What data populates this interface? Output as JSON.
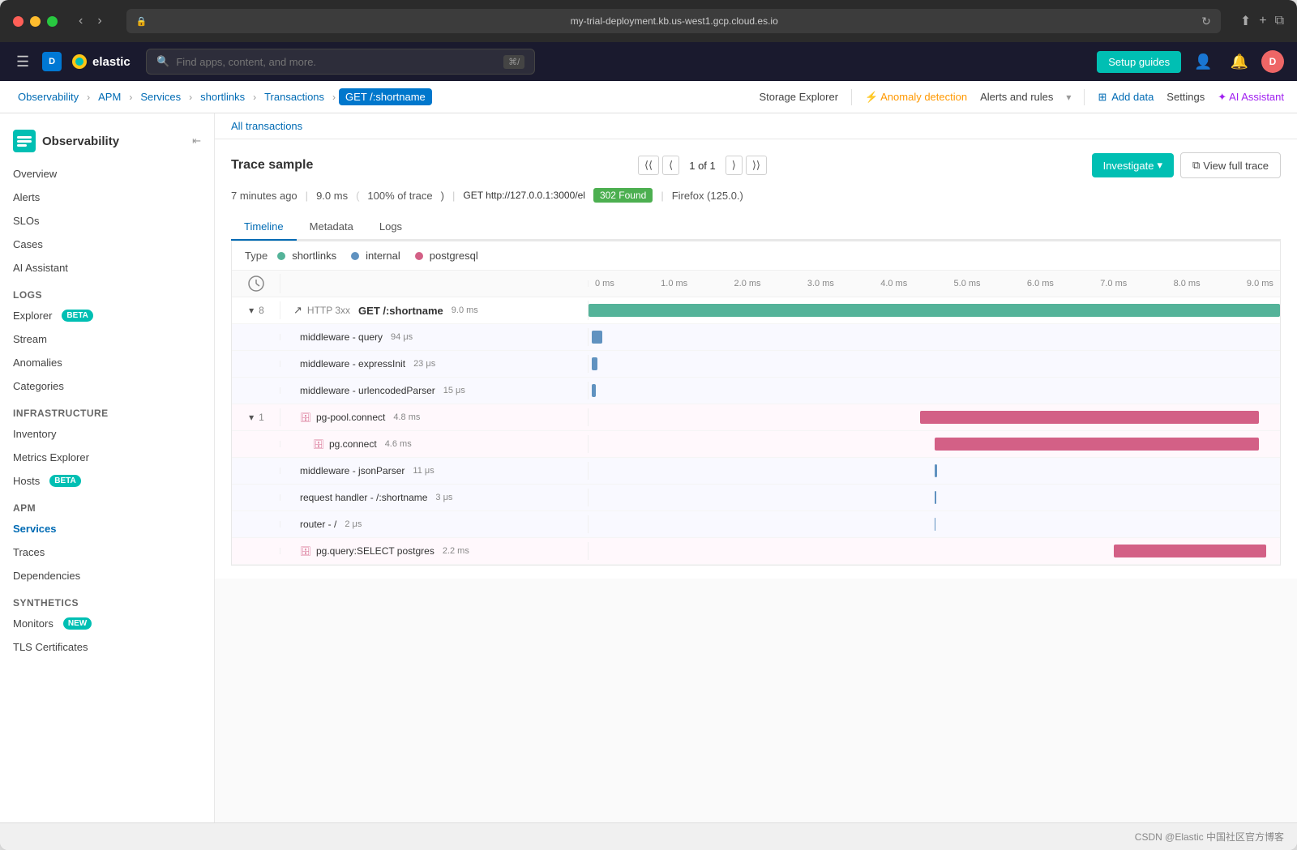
{
  "window": {
    "url": "my-trial-deployment.kb.us-west1.gcp.cloud.es.io"
  },
  "topnav": {
    "search_placeholder": "Find apps, content, and more.",
    "search_kbd": "⌘/",
    "setup_guides": "Setup guides",
    "app_initial": "D"
  },
  "breadcrumbs": [
    {
      "label": "Observability",
      "active": false
    },
    {
      "label": "APM",
      "active": false
    },
    {
      "label": "Services",
      "active": false
    },
    {
      "label": "shortlinks",
      "active": false
    },
    {
      "label": "Transactions",
      "active": false
    },
    {
      "label": "GET /:shortname",
      "active": true
    }
  ],
  "topbar_links": [
    {
      "label": "Storage Explorer",
      "type": "plain"
    },
    {
      "label": "Anomaly detection",
      "type": "anomaly"
    },
    {
      "label": "Alerts and rules",
      "type": "plain"
    },
    {
      "label": "Add data",
      "type": "add"
    },
    {
      "label": "Settings",
      "type": "plain"
    },
    {
      "label": "AI Assistant",
      "type": "ai"
    }
  ],
  "sidebar": {
    "title": "Observability",
    "items_top": [
      {
        "label": "Overview",
        "active": false
      },
      {
        "label": "Alerts",
        "active": false
      },
      {
        "label": "SLOs",
        "active": false
      },
      {
        "label": "Cases",
        "active": false
      },
      {
        "label": "AI Assistant",
        "active": false
      }
    ],
    "sections": [
      {
        "label": "Logs",
        "items": [
          {
            "label": "Explorer",
            "badge": "BETA",
            "active": false
          },
          {
            "label": "Stream",
            "active": false
          },
          {
            "label": "Anomalies",
            "active": false
          },
          {
            "label": "Categories",
            "active": false
          }
        ]
      },
      {
        "label": "Infrastructure",
        "items": [
          {
            "label": "Inventory",
            "active": false
          },
          {
            "label": "Metrics Explorer",
            "active": false
          },
          {
            "label": "Hosts",
            "badge": "BETA",
            "active": false
          }
        ]
      },
      {
        "label": "APM",
        "items": [
          {
            "label": "Services",
            "active": true
          },
          {
            "label": "Traces",
            "active": false
          },
          {
            "label": "Dependencies",
            "active": false
          }
        ]
      },
      {
        "label": "Synthetics",
        "items": [
          {
            "label": "Monitors",
            "badge": "NEW",
            "active": false
          },
          {
            "label": "TLS Certificates",
            "active": false
          }
        ]
      }
    ]
  },
  "transactions_notice": {
    "text": "All transactions"
  },
  "trace_sample": {
    "title": "Trace sample",
    "page_current": "1",
    "page_total": "1",
    "investigate_label": "Investigate",
    "view_full_trace": "View full trace",
    "time_ago": "7 minutes ago",
    "duration": "9.0 ms",
    "duration_pct": "100% of trace",
    "url": "GET http://127.0.0.1:3000/el",
    "status": "302 Found",
    "browser": "Firefox (125.0.)"
  },
  "tabs": [
    {
      "label": "Timeline",
      "active": true
    },
    {
      "label": "Metadata",
      "active": false
    },
    {
      "label": "Logs",
      "active": false
    }
  ],
  "timeline": {
    "type_label": "Type",
    "types": [
      {
        "label": "shortlinks",
        "color": "#54b399"
      },
      {
        "label": "internal",
        "color": "#6092c0"
      },
      {
        "label": "postgresql",
        "color": "#d36086"
      }
    ],
    "time_axis": [
      "0 ms",
      "1.0 ms",
      "2.0 ms",
      "3.0 ms",
      "4.0 ms",
      "5.0 ms",
      "6.0 ms",
      "7.0 ms",
      "8.0 ms",
      "9.0 ms"
    ],
    "rows": [
      {
        "num": "8",
        "expandable": true,
        "expanded": true,
        "indent": 0,
        "icon": "→",
        "label": "HTTP 3xx  GET /:shortname",
        "duration": "9.0 ms",
        "bar_left_pct": 0,
        "bar_width_pct": 100,
        "bar_color": "#54b399"
      },
      {
        "num": "",
        "expandable": false,
        "indent": 1,
        "icon": "",
        "label": "middleware - query",
        "duration": "94 μs",
        "bar_left_pct": 0.5,
        "bar_width_pct": 1.5,
        "bar_color": "#6092c0"
      },
      {
        "num": "",
        "expandable": false,
        "indent": 1,
        "icon": "",
        "label": "middleware - expressInit",
        "duration": "23 μs",
        "bar_left_pct": 0.5,
        "bar_width_pct": 0.6,
        "bar_color": "#6092c0"
      },
      {
        "num": "",
        "expandable": false,
        "indent": 1,
        "icon": "",
        "label": "middleware - urlencodedParser",
        "duration": "15 μs",
        "bar_left_pct": 0.5,
        "bar_width_pct": 0.4,
        "bar_color": "#6092c0"
      },
      {
        "num": "1",
        "expandable": true,
        "expanded": true,
        "indent": 1,
        "icon": "db",
        "label": "pg-pool.connect",
        "duration": "4.8 ms",
        "bar_left_pct": 48,
        "bar_width_pct": 49,
        "bar_color": "#d36086"
      },
      {
        "num": "",
        "expandable": false,
        "indent": 2,
        "icon": "db",
        "label": "pg.connect",
        "duration": "4.6 ms",
        "bar_left_pct": 50,
        "bar_width_pct": 47,
        "bar_color": "#d36086"
      },
      {
        "num": "",
        "expandable": false,
        "indent": 1,
        "icon": "",
        "label": "middleware - jsonParser",
        "duration": "11 μs",
        "bar_left_pct": 50,
        "bar_width_pct": 0.3,
        "bar_color": "#6092c0"
      },
      {
        "num": "",
        "expandable": false,
        "indent": 1,
        "icon": "",
        "label": "request handler - /:shortname",
        "duration": "3 μs",
        "bar_left_pct": 50,
        "bar_width_pct": 0.2,
        "bar_color": "#6092c0"
      },
      {
        "num": "",
        "expandable": false,
        "indent": 1,
        "icon": "",
        "label": "router - /",
        "duration": "2 μs",
        "bar_left_pct": 50,
        "bar_width_pct": 0.15,
        "bar_color": "#6092c0"
      },
      {
        "num": "",
        "expandable": false,
        "indent": 1,
        "icon": "db",
        "label": "pg.query:SELECT postgres",
        "duration": "2.2 ms",
        "bar_left_pct": 76,
        "bar_width_pct": 22,
        "bar_color": "#d36086"
      }
    ]
  },
  "footer": {
    "text": "CSDN @Elastic 中国社区官方博客"
  }
}
